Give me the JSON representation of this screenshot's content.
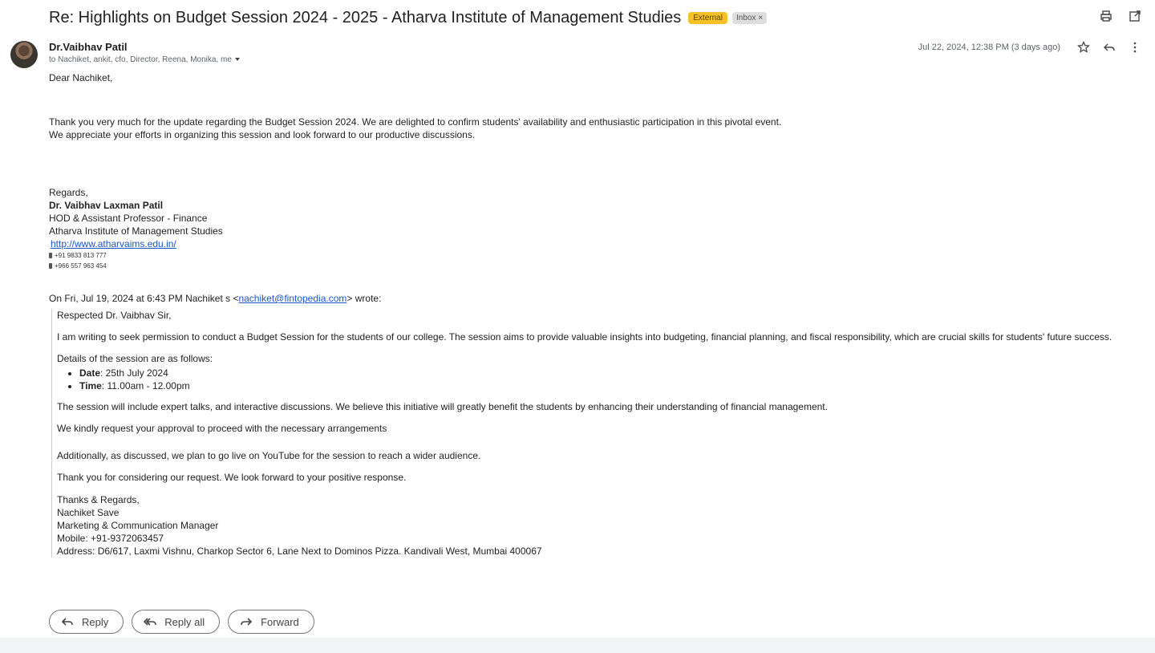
{
  "subject": "Re: Highlights on Budget Session 2024 - 2025 - Atharva Institute of Management Studies",
  "labels": {
    "external": "External",
    "inbox": "Inbox",
    "remove": "×"
  },
  "sender": {
    "name": "Dr.Vaibhav Patil",
    "recipients": "to Nachiket, ankit, cfo, Director, Reena, Monika, me"
  },
  "date": "Jul 22, 2024, 12:38 PM (3 days ago)",
  "body": {
    "greeting": "Dear Nachiket,",
    "line1": "Thank you very much for the update regarding the Budget Session 2024. We are delighted to confirm students' availability and enthusiastic participation in this pivotal event.",
    "line2": "We appreciate your efforts in organizing this session and look forward to our productive discussions.",
    "regards": "Regards,",
    "sig_name": "Dr. Vaibhav Laxman Patil",
    "sig_title": "HOD & Assistant Professor - Finance",
    "sig_org": "Atharva Institute of Management Studies",
    "sig_url": "http://www.atharvaims.edu.in/",
    "phone1": "+91 9833 813 777",
    "phone2": "+966 557 963 454"
  },
  "quote": {
    "intro_pre": "On Fri, Jul 19, 2024 at 6:43 PM Nachiket s <",
    "intro_email": "nachiket@fintopedia.com",
    "intro_post": "> wrote:",
    "salutation": "Respected Dr. Vaibhav Sir,",
    "p1": "I am writing to seek permission to conduct a Budget Session for the students of our college. The session aims to provide valuable insights into budgeting, financial planning, and fiscal responsibility, which are crucial skills for students' future success.",
    "p2": "Details of the session are as follows:",
    "bullets": [
      {
        "label": "Date",
        "value": ": 25th July 2024"
      },
      {
        "label": "Time",
        "value": ": 11.00am - 12.00pm"
      }
    ],
    "p3": "The session will include expert talks, and interactive discussions. We believe this initiative will greatly benefit the students by enhancing their understanding of financial management.",
    "p4": "We kindly request your approval to proceed with the necessary arrangements",
    "p5": "Additionally, as discussed, we plan to go live on YouTube for the session to reach a wider audience.",
    "p6": "Thank you for considering our request. We look forward to your positive response.",
    "sig1": "Thanks & Regards,",
    "sig2": "Nachiket Save",
    "sig3": "Marketing & Communication Manager",
    "sig4": "Mobile: +91-9372063457",
    "sig5": "Address: D6/617, Laxmi Vishnu, Charkop Sector 6, Lane Next to Dominos Pizza. Kandivali West, Mumbai 400067"
  },
  "actions": {
    "reply": "Reply",
    "reply_all": "Reply all",
    "forward": "Forward"
  },
  "colors": {
    "external_label": "#f6c026",
    "link": "#1a55cc"
  }
}
